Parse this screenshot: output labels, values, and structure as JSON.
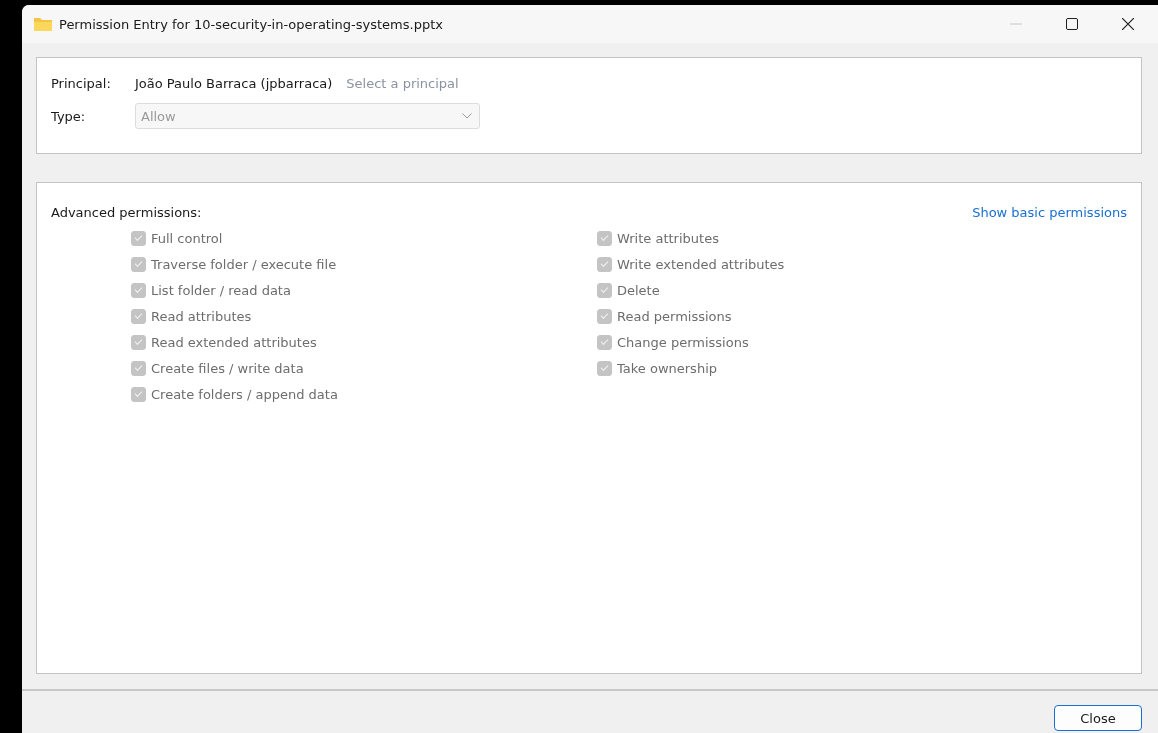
{
  "window": {
    "title": "Permission Entry for 10-security-in-operating-systems.pptx",
    "minimize_disabled": true
  },
  "principal": {
    "label": "Principal:",
    "value": "João Paulo Barraca (jpbarraca)",
    "link": "Select a principal"
  },
  "type": {
    "label": "Type:",
    "value": "Allow",
    "disabled": true
  },
  "permissions": {
    "heading": "Advanced permissions:",
    "toggle_link": "Show basic permissions",
    "columns": [
      [
        {
          "label": "Full control",
          "checked": true,
          "disabled": true
        },
        {
          "label": "Traverse folder / execute file",
          "checked": true,
          "disabled": true
        },
        {
          "label": "List folder / read data",
          "checked": true,
          "disabled": true
        },
        {
          "label": "Read attributes",
          "checked": true,
          "disabled": true
        },
        {
          "label": "Read extended attributes",
          "checked": true,
          "disabled": true
        },
        {
          "label": "Create files / write data",
          "checked": true,
          "disabled": true
        },
        {
          "label": "Create folders / append data",
          "checked": true,
          "disabled": true
        }
      ],
      [
        {
          "label": "Write attributes",
          "checked": true,
          "disabled": true
        },
        {
          "label": "Write extended attributes",
          "checked": true,
          "disabled": true
        },
        {
          "label": "Delete",
          "checked": true,
          "disabled": true
        },
        {
          "label": "Read permissions",
          "checked": true,
          "disabled": true
        },
        {
          "label": "Change permissions",
          "checked": true,
          "disabled": true
        },
        {
          "label": "Take ownership",
          "checked": true,
          "disabled": true
        }
      ]
    ]
  },
  "buttons": [
    "Close"
  ]
}
